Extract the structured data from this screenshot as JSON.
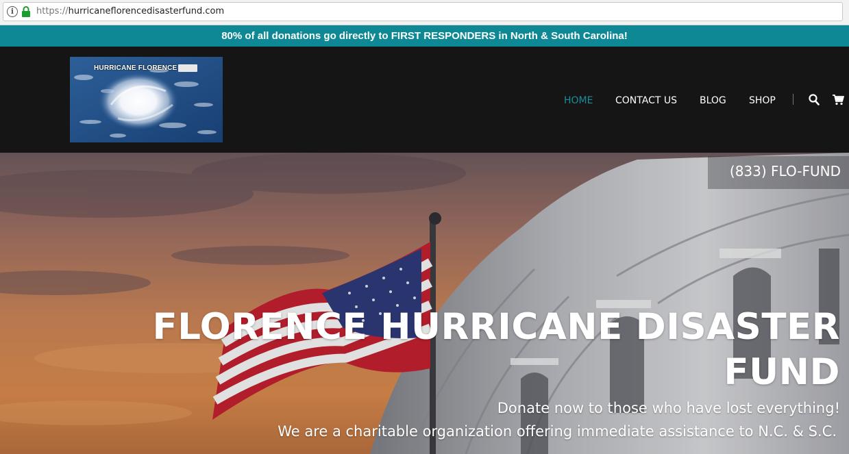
{
  "browser": {
    "url_scheme": "https://",
    "url_host": "hurricaneflorencedisasterfund.com"
  },
  "announcement": "80% of all donations go directly to FIRST RESPONDERS in North & South Carolina!",
  "header": {
    "logo_text": "HURRICANE FLORENCE",
    "nav": [
      {
        "label": "HOME",
        "active": true
      },
      {
        "label": "CONTACT US",
        "active": false
      },
      {
        "label": "BLOG",
        "active": false
      },
      {
        "label": "SHOP",
        "active": false
      }
    ]
  },
  "hero": {
    "phone": "(833) FLO-FUND",
    "title_line1": "FLORENCE HURRICANE DISASTER",
    "title_line2": "FUND",
    "subtitle1": "Donate now to those who have lost everything!",
    "subtitle2": "We are a charitable organization offering immediate assistance to N.C. & S.C."
  },
  "colors": {
    "accent": "#0d8894",
    "nav_active": "#1b8e9c",
    "header_bg": "#151515"
  },
  "icons": [
    "info-icon",
    "lock-icon",
    "search-icon",
    "cart-icon"
  ]
}
